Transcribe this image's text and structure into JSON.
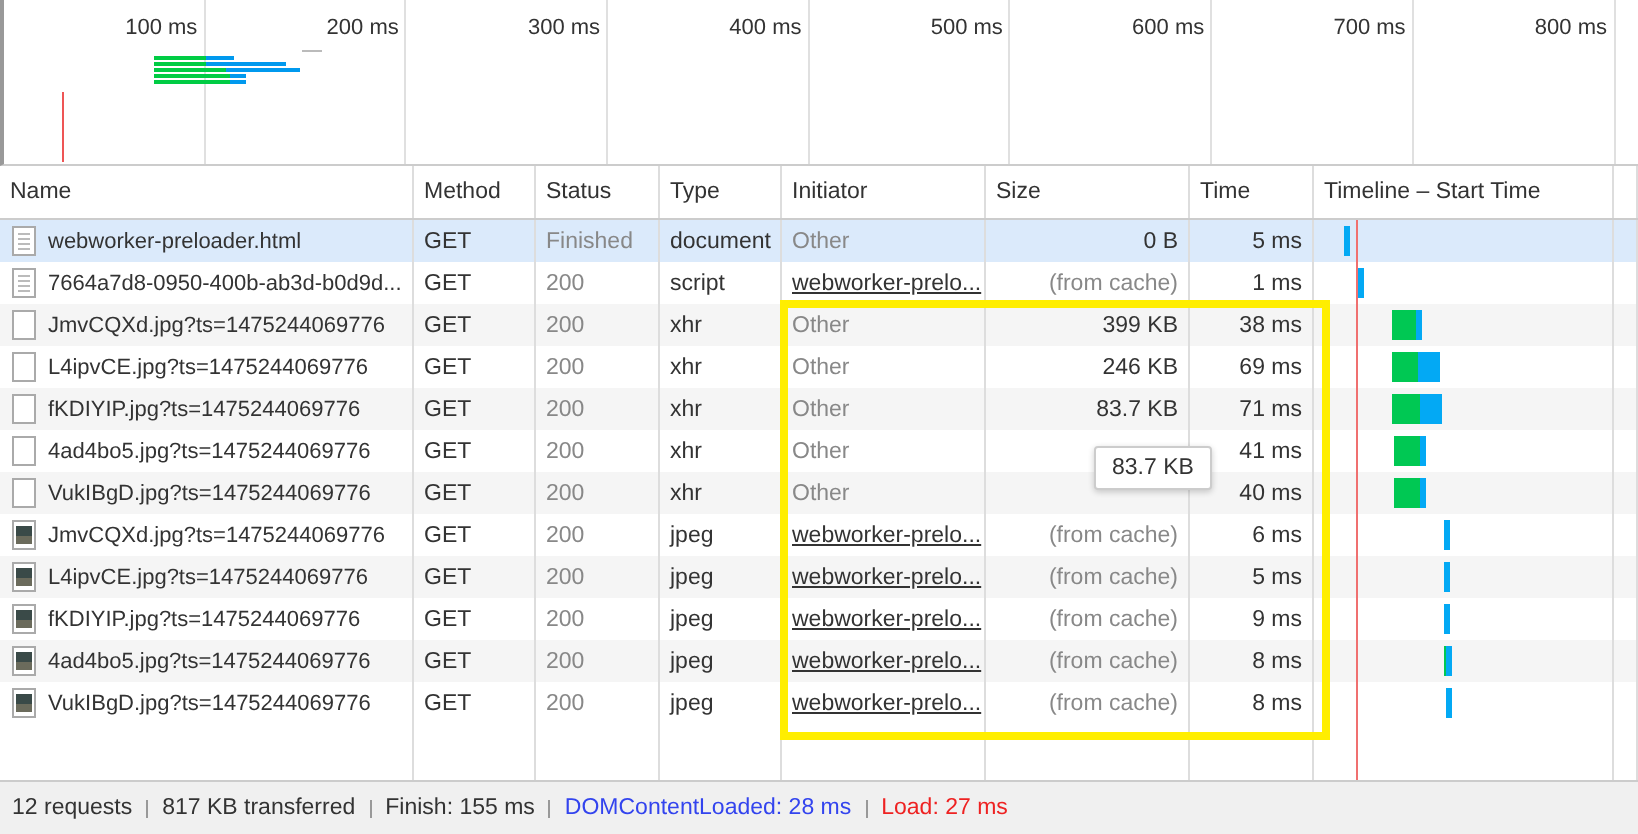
{
  "overview": {
    "ticks": [
      "100 ms",
      "200 ms",
      "300 ms",
      "400 ms",
      "500 ms",
      "600 ms",
      "700 ms",
      "800 ms"
    ]
  },
  "table": {
    "columns": [
      "Name",
      "Method",
      "Status",
      "Type",
      "Initiator",
      "Size",
      "Time",
      "Timeline – Start Time"
    ],
    "rows": [
      {
        "kind": "doc",
        "name": "webworker-preloader.html",
        "method": "GET",
        "status": "Finished",
        "type": "document",
        "initiator": "Other",
        "initiator_link": false,
        "size": "0 B",
        "time": "5 ms",
        "selected": true
      },
      {
        "kind": "doc",
        "name": "7664a7d8-0950-400b-ab3d-b0d9d...",
        "method": "GET",
        "status": "200",
        "type": "script",
        "initiator": "webworker-prelo...",
        "initiator_link": true,
        "size": "(from cache)",
        "time": "1 ms",
        "selected": false
      },
      {
        "kind": "plain",
        "name": "JmvCQXd.jpg?ts=1475244069776",
        "method": "GET",
        "status": "200",
        "type": "xhr",
        "initiator": "Other",
        "initiator_link": false,
        "size": "399 KB",
        "time": "38 ms",
        "selected": false
      },
      {
        "kind": "plain",
        "name": "L4ipvCE.jpg?ts=1475244069776",
        "method": "GET",
        "status": "200",
        "type": "xhr",
        "initiator": "Other",
        "initiator_link": false,
        "size": "246 KB",
        "time": "69 ms",
        "selected": false
      },
      {
        "kind": "plain",
        "name": "fKDIYIP.jpg?ts=1475244069776",
        "method": "GET",
        "status": "200",
        "type": "xhr",
        "initiator": "Other",
        "initiator_link": false,
        "size": "83.7 KB",
        "time": "71 ms",
        "selected": false
      },
      {
        "kind": "plain",
        "name": "4ad4bo5.jpg?ts=1475244069776",
        "method": "GET",
        "status": "200",
        "type": "xhr",
        "initiator": "Other",
        "initiator_link": false,
        "time": "41 ms",
        "selected": false
      },
      {
        "kind": "plain",
        "name": "VukIBgD.jpg?ts=1475244069776",
        "method": "GET",
        "status": "200",
        "type": "xhr",
        "initiator": "Other",
        "initiator_link": false,
        "time": "40 ms",
        "selected": false
      },
      {
        "kind": "thumb",
        "name": "JmvCQXd.jpg?ts=1475244069776",
        "method": "GET",
        "status": "200",
        "type": "jpeg",
        "initiator": "webworker-prelo...",
        "initiator_link": true,
        "size": "(from cache)",
        "time": "6 ms",
        "selected": false
      },
      {
        "kind": "thumb",
        "name": "L4ipvCE.jpg?ts=1475244069776",
        "method": "GET",
        "status": "200",
        "type": "jpeg",
        "initiator": "webworker-prelo...",
        "initiator_link": true,
        "size": "(from cache)",
        "time": "5 ms",
        "selected": false
      },
      {
        "kind": "thumb",
        "name": "fKDIYIP.jpg?ts=1475244069776",
        "method": "GET",
        "status": "200",
        "type": "jpeg",
        "initiator": "webworker-prelo...",
        "initiator_link": true,
        "size": "(from cache)",
        "time": "9 ms",
        "selected": false
      },
      {
        "kind": "thumb",
        "name": "4ad4bo5.jpg?ts=1475244069776",
        "method": "GET",
        "status": "200",
        "type": "jpeg",
        "initiator": "webworker-prelo...",
        "initiator_link": true,
        "size": "(from cache)",
        "time": "8 ms",
        "selected": false
      },
      {
        "kind": "thumb",
        "name": "VukIBgD.jpg?ts=1475244069776",
        "method": "GET",
        "status": "200",
        "type": "jpeg",
        "initiator": "webworker-prelo...",
        "initiator_link": true,
        "size": "(from cache)",
        "time": "8 ms",
        "selected": false
      }
    ]
  },
  "tooltip": {
    "text": "83.7 KB"
  },
  "status_bar": [
    {
      "kind": "plain",
      "text": "12 requests"
    },
    {
      "kind": "plain",
      "text": "817 KB transferred"
    },
    {
      "kind": "plain",
      "text": "Finish: 155 ms"
    },
    {
      "kind": "dom",
      "text": "DOMContentLoaded: 28 ms"
    },
    {
      "kind": "load",
      "text": "Load: 27 ms"
    }
  ]
}
